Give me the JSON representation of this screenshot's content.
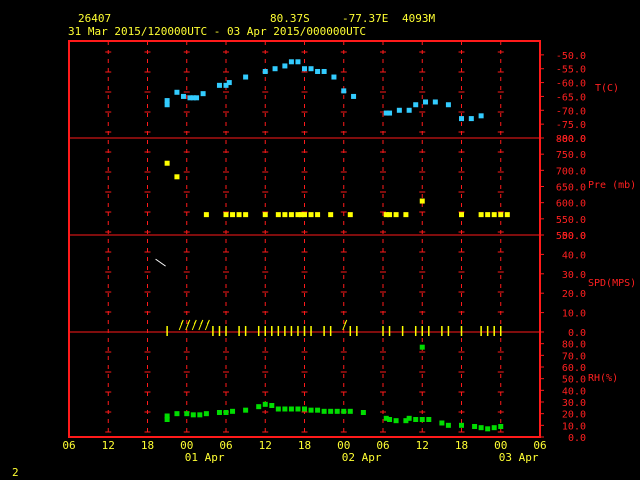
{
  "header": {
    "station_id": "26407",
    "latitude": "80.37S",
    "longitude": "-77.37E",
    "elevation": "4093M",
    "time_range": "31 Mar 2015/120000UTC - 03 Apr 2015/000000UTC"
  },
  "footer_page": "2",
  "colors": {
    "frame": "#ff1a1a",
    "grid": "#ff1a1a",
    "text": "#ffff33",
    "temperature": "#33ccff",
    "pressure": "#ffff00",
    "wind": "#ffff00",
    "rh": "#00dd00"
  },
  "x_axis": {
    "hour_labels": [
      "06",
      "12",
      "18",
      "00",
      "06",
      "12",
      "18",
      "00",
      "06",
      "12",
      "18",
      "00",
      "06"
    ],
    "day_labels": [
      "01 Apr",
      "02 Apr",
      "03 Apr"
    ]
  },
  "chart_data": [
    {
      "type": "scatter",
      "name": "temperature",
      "label": "T(C)",
      "ylim": [
        -80,
        -45
      ],
      "ticks": [
        "-50.0",
        "-55.0",
        "-60.0",
        "-65.0",
        "-70.0",
        "-75.0",
        "-80.0"
      ],
      "x": [
        15,
        15,
        16.5,
        17.5,
        18.5,
        19,
        19.5,
        20.5,
        23,
        24,
        24.5,
        27,
        30,
        31.5,
        33,
        34,
        35,
        36,
        37,
        38,
        39,
        40.5,
        42,
        43.5,
        48.5,
        49,
        50.5,
        52,
        53,
        54.5,
        56,
        58,
        60,
        61.5,
        63
      ],
      "y": [
        -68,
        -66.5,
        -63.5,
        -65,
        -65.5,
        -65.5,
        -65.5,
        -64,
        -61,
        -61,
        -60,
        -58,
        -56,
        -55,
        -54,
        -52.5,
        -52.5,
        -55,
        -55,
        -56,
        -56,
        -58,
        -63,
        -65,
        -71,
        -71,
        -70,
        -70,
        -68,
        -67,
        -67,
        -68,
        -73,
        -73,
        -72
      ]
    },
    {
      "type": "scatter",
      "name": "pressure",
      "label": "Pre (mb)",
      "ylim": [
        500,
        800
      ],
      "ticks": [
        "800.0",
        "750.0",
        "700.0",
        "650.0",
        "600.0",
        "550.0",
        "500.0"
      ],
      "x": [
        15,
        16.5,
        21,
        24,
        25,
        26,
        27,
        30,
        32,
        33,
        34,
        35,
        35.5,
        36,
        37,
        38,
        40,
        43,
        48.5,
        49,
        50,
        51.5,
        54,
        60,
        63,
        64,
        65,
        66,
        67
      ],
      "y": [
        722,
        680,
        563,
        563,
        563,
        563,
        563,
        563,
        563,
        563,
        563,
        563,
        563,
        563,
        563,
        563,
        563,
        563,
        563,
        563,
        563,
        563,
        605,
        563,
        563,
        563,
        563,
        563,
        563
      ]
    },
    {
      "type": "scatter",
      "name": "wind_speed",
      "label": "SPD(MPS)",
      "ylim": [
        0,
        50
      ],
      "ticks": [
        "50.0",
        "40.0",
        "30.0",
        "20.0",
        "10.0",
        "0.0"
      ],
      "x": [
        14,
        15,
        17,
        18,
        19,
        20,
        21,
        22,
        23,
        24,
        26,
        27,
        29,
        30,
        31,
        32,
        33,
        34,
        35,
        36,
        37,
        39,
        40,
        42,
        43,
        44,
        48,
        49,
        51,
        53,
        54,
        55,
        57,
        58,
        60,
        63,
        64,
        65,
        66
      ],
      "y": [
        35,
        0,
        2,
        1,
        1,
        1,
        1,
        0,
        0,
        0,
        0,
        0,
        0,
        0,
        0,
        0,
        0,
        0,
        0,
        0,
        0,
        0,
        0,
        2,
        0,
        0,
        0,
        0,
        0,
        0,
        0,
        0,
        0,
        0,
        0,
        0,
        0,
        0,
        0
      ]
    },
    {
      "type": "scatter",
      "name": "relative_humidity",
      "label": "RH(%)",
      "ylim": [
        0,
        90
      ],
      "ticks": [
        "80.0",
        "70.0",
        "60.0",
        "50.0",
        "40.0",
        "30.0",
        "20.0",
        "10.0",
        "0.0"
      ],
      "x": [
        15,
        15,
        16.5,
        18,
        19,
        20,
        21,
        23,
        24,
        25,
        27,
        29,
        30,
        31,
        32,
        33,
        34,
        35,
        36,
        37,
        38,
        39,
        40,
        41,
        42,
        43,
        45,
        48.5,
        49,
        50,
        51.5,
        52,
        53,
        54,
        55,
        57,
        58,
        60,
        62,
        63,
        64,
        65,
        66
      ],
      "y": [
        15,
        18,
        20,
        20,
        19,
        19,
        20,
        21,
        21,
        22,
        23,
        26,
        28,
        27,
        24,
        24,
        24,
        24,
        24,
        23,
        23,
        22,
        22,
        22,
        22,
        22,
        21,
        16,
        15,
        14,
        14,
        16,
        15,
        15,
        15,
        12,
        10,
        10,
        9,
        8,
        7,
        8,
        9
      ],
      "extra_point": [
        54,
        77
      ]
    }
  ]
}
